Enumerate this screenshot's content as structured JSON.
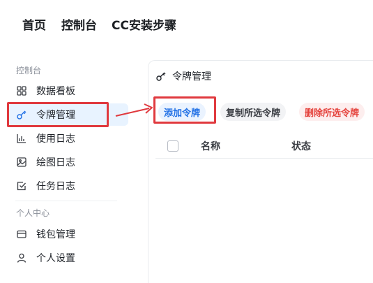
{
  "topnav": {
    "links": [
      "首页",
      "控制台",
      "CC安装步骤"
    ]
  },
  "sidebar": {
    "section_console": "控制台",
    "section_personal": "个人中心",
    "items": [
      {
        "label": "数据看板",
        "icon": "grid-icon"
      },
      {
        "label": "令牌管理",
        "icon": "key-icon",
        "active": true
      },
      {
        "label": "使用日志",
        "icon": "bar-chart-icon"
      },
      {
        "label": "绘图日志",
        "icon": "image-icon"
      },
      {
        "label": "任务日志",
        "icon": "checkbox-icon"
      },
      {
        "label": "钱包管理",
        "icon": "wallet-icon"
      },
      {
        "label": "个人设置",
        "icon": "user-icon"
      }
    ]
  },
  "panel": {
    "title": "令牌管理",
    "title_icon": "key-icon",
    "buttons": {
      "add": "添加令牌",
      "copy": "复制所选令牌",
      "delete": "删除所选令牌"
    },
    "columns": [
      "名称",
      "状态"
    ]
  },
  "colors": {
    "accent": "#1f6fe5",
    "active_bg": "#e8f3ff",
    "danger": "#e5433d",
    "highlight": "#e0393e"
  }
}
